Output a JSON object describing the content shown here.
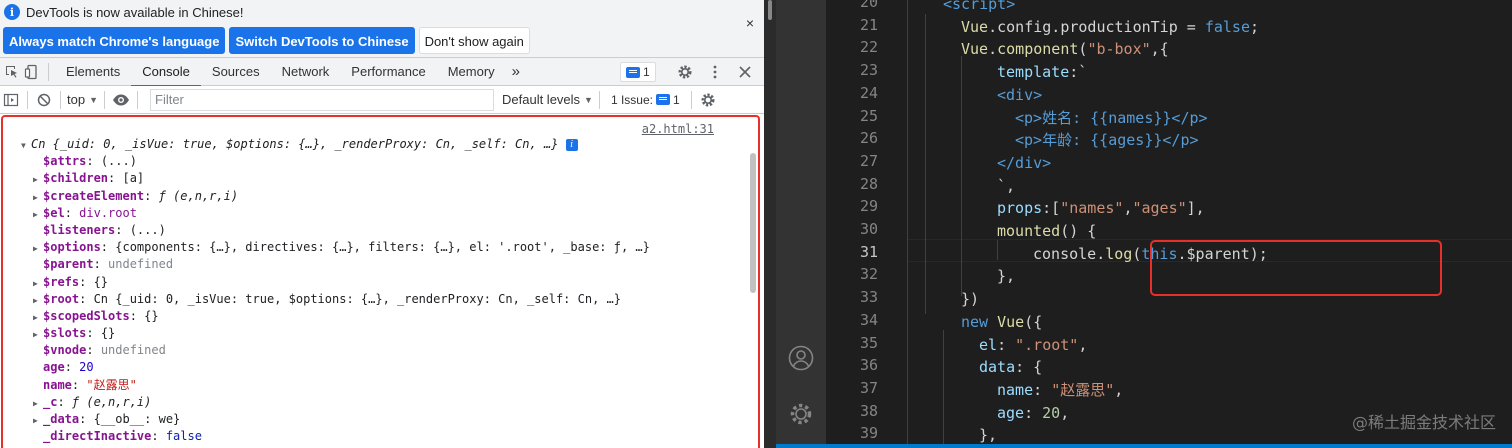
{
  "infobar": {
    "message": "DevTools is now available in Chinese!",
    "buttons": [
      "Always match Chrome's language",
      "Switch DevTools to Chinese",
      "Don't show again"
    ],
    "close_symbol": "×"
  },
  "tabs": [
    "Elements",
    "Console",
    "Sources",
    "Network",
    "Performance",
    "Memory"
  ],
  "active_tab": "Console",
  "more_tabs_symbol": "»",
  "messages_badge": "1",
  "filterbar": {
    "context": "top",
    "filter_placeholder": "Filter",
    "levels": "Default levels",
    "issues_label": "1 Issue:",
    "issues_count": "1"
  },
  "console": {
    "source_link": "a2.html:31",
    "header": "Cn {_uid: 0, _isVue: true, $options: {…}, _renderProxy: Cn, _self: Cn, …}",
    "rows": [
      {
        "expand": false,
        "key": "$attrs",
        "value": "(...)"
      },
      {
        "expand": true,
        "key": "$children",
        "value": "[a]"
      },
      {
        "expand": true,
        "key": "$createElement",
        "value": "ƒ (e,n,r,i)"
      },
      {
        "expand": true,
        "key": "$el",
        "value": "div.root"
      },
      {
        "expand": false,
        "key": "$listeners",
        "value": "(...)"
      },
      {
        "expand": true,
        "key": "$options",
        "value": "{components: {…}, directives: {…}, filters: {…}, el: '.root', _base: ƒ, …}"
      },
      {
        "expand": false,
        "key": "$parent",
        "value": "undefined"
      },
      {
        "expand": true,
        "key": "$refs",
        "value": "{}"
      },
      {
        "expand": true,
        "key": "$root",
        "value": "Cn {_uid: 0, _isVue: true, $options: {…}, _renderProxy: Cn, _self: Cn, …}"
      },
      {
        "expand": true,
        "key": "$scopedSlots",
        "value": "{}"
      },
      {
        "expand": true,
        "key": "$slots",
        "value": "{}"
      },
      {
        "expand": false,
        "key": "$vnode",
        "value": "undefined"
      },
      {
        "expand": false,
        "key": "age",
        "value": "20"
      },
      {
        "expand": false,
        "key": "name",
        "value": "\"赵露思\""
      },
      {
        "expand": true,
        "key": "_c",
        "value": "ƒ (e,n,r,i)"
      },
      {
        "expand": true,
        "key": "_data",
        "value": "{__ob__: we}"
      },
      {
        "expand": false,
        "key": "_directInactive",
        "value": "false"
      }
    ]
  },
  "editor": {
    "line_numbers": [
      "20",
      "21",
      "22",
      "23",
      "24",
      "25",
      "26",
      "27",
      "28",
      "29",
      "30",
      "31",
      "32",
      "33",
      "34",
      "35",
      "36",
      "37",
      "38",
      "39"
    ],
    "current_line": "31",
    "lines": [
      "<script>",
      "Vue.config.productionTip = false;",
      "Vue.component(\"b-box\",{",
      "template:`",
      "<div>",
      "<p>姓名: {{names}}</p>",
      "<p>年龄: {{ages}}</p>",
      "</div>",
      "`,",
      "props:[\"names\",\"ages\"],",
      "mounted() {",
      "console.log(this.$parent);",
      "},",
      "})",
      "new Vue({",
      "el: \".root\",",
      "data: {",
      "name: \"赵露思\",",
      "age: 20,",
      "},"
    ],
    "watermark": "@稀土掘金技术社区"
  },
  "icons": {
    "inspect": "inspect-icon",
    "device": "device-toggle-icon",
    "settings": "gear-icon",
    "menu": "kebab-menu-icon",
    "close": "close-icon",
    "sidebar": "sidebar-toggle-icon",
    "clear": "clear-console-icon",
    "eye": "eye-icon",
    "account": "account-icon",
    "manage": "manage-gear-icon"
  },
  "colors": {
    "accent": "#1a73e8",
    "highlight_box": "#e8302b",
    "editor_bg": "#1e1e1e"
  }
}
